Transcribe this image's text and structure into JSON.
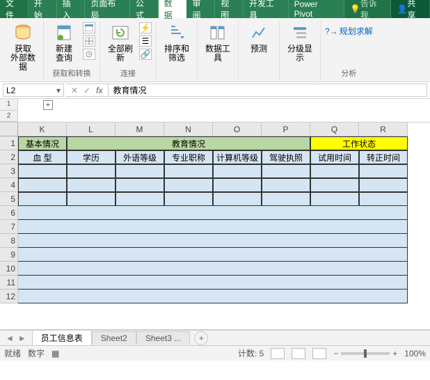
{
  "titlebar": {
    "file": "文件",
    "tabs": [
      "开始",
      "插入",
      "页面布局",
      "公式",
      "数据",
      "审阅",
      "视图",
      "开发工具",
      "Power Pivot"
    ],
    "active": "数据",
    "tellme": "告诉我",
    "share": "共享"
  },
  "ribbon": {
    "getdata": {
      "btn": "获取\n外部数据",
      "label": ""
    },
    "newquery": {
      "btn": "新建\n查询",
      "label": "获取和转换"
    },
    "refresh": {
      "btn": "全部刷新",
      "label": "连接"
    },
    "sort": {
      "btn": "排序和筛选"
    },
    "tools": {
      "btn": "数据工具"
    },
    "forecast": {
      "btn": "预测"
    },
    "outline": {
      "btn": "分级显示"
    },
    "solver": {
      "link": "规划求解",
      "label": "分析"
    }
  },
  "namebox": "L2",
  "formula": "教育情况",
  "outline_levels": [
    "1",
    "2"
  ],
  "columns": [
    "K",
    "L",
    "M",
    "N",
    "O",
    "P",
    "Q",
    "R"
  ],
  "rows": [
    "1",
    "2",
    "3",
    "4",
    "5",
    "6",
    "7",
    "8",
    "9",
    "10",
    "11",
    "12"
  ],
  "row1": {
    "k": "基本情况",
    "merged_edu": "教育情况",
    "merged_work": "工作状态"
  },
  "row2": {
    "k": "血   型",
    "l": "学历",
    "m": "外语等级",
    "n": "专业职称",
    "o": "计算机等级",
    "p": "驾驶执照",
    "q": "试用时间",
    "r": "转正时间"
  },
  "sheets": {
    "active": "员工信息表",
    "others": [
      "Sheet2",
      "Sheet3 ..."
    ]
  },
  "status": {
    "ready": "就绪",
    "mode": "数字",
    "count_label": "计数:",
    "count": "5",
    "zoom": "100%"
  }
}
